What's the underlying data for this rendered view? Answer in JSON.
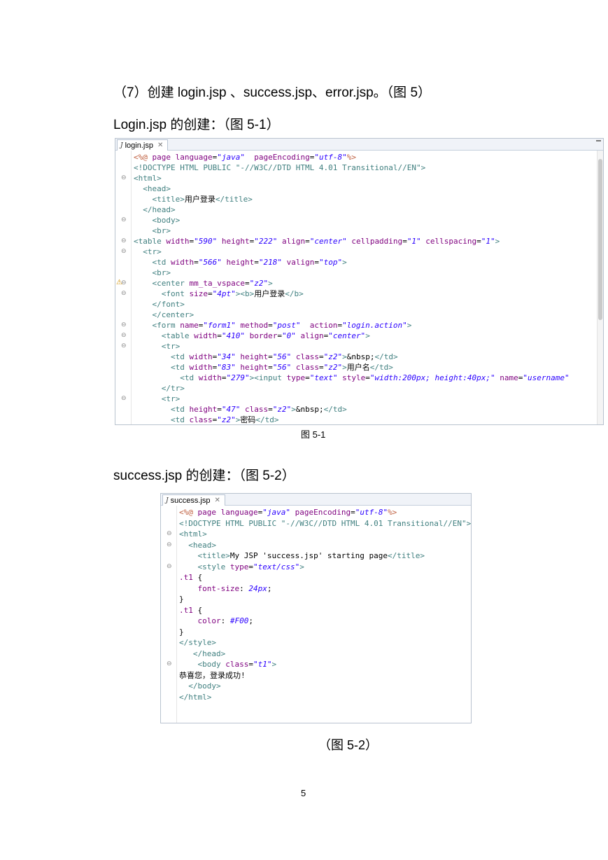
{
  "heading": "（7）创建 login.jsp  、success.jsp、error.jsp。（图 5）",
  "login_intro": "Login.jsp 的创建：（图 5-1）",
  "login_editor": {
    "tab": "login.jsp",
    "lines": [
      [
        [
          "dl",
          "<%@"
        ],
        [
          "at",
          " page "
        ],
        [
          "at",
          "language"
        ],
        [
          "tx",
          "="
        ],
        [
          "vl",
          "\"java\""
        ],
        [
          "tx",
          "  "
        ],
        [
          "at",
          "pageEncoding"
        ],
        [
          "tx",
          "="
        ],
        [
          "vl",
          "\"utf-8\""
        ],
        [
          "dl",
          "%>"
        ]
      ],
      [
        [
          "tg",
          "<!DOCTYPE HTML PUBLIC \"-//W3C//DTD HTML 4.01 Transitional//EN\">"
        ]
      ],
      [
        [
          "tg",
          "<html>"
        ]
      ],
      [
        [
          "tg",
          "  <head>"
        ]
      ],
      [
        [
          "tg",
          "    <title>"
        ],
        [
          "tx",
          "用户登录"
        ],
        [
          "tg",
          "</title>"
        ]
      ],
      [
        [
          "tg",
          "  </head>"
        ]
      ],
      [
        [
          "tg",
          "    <body>"
        ]
      ],
      [
        [
          "tg",
          "    <br>"
        ]
      ],
      [
        [
          "tg",
          "<table "
        ],
        [
          "at",
          "width"
        ],
        [
          "tx",
          "="
        ],
        [
          "vl",
          "\"590\""
        ],
        [
          "at",
          " height"
        ],
        [
          "tx",
          "="
        ],
        [
          "vl",
          "\"222\""
        ],
        [
          "at",
          " align"
        ],
        [
          "tx",
          "="
        ],
        [
          "vl",
          "\"center\""
        ],
        [
          "at",
          " cellpadding"
        ],
        [
          "tx",
          "="
        ],
        [
          "vl",
          "\"1\""
        ],
        [
          "at",
          " cellspacing"
        ],
        [
          "tx",
          "="
        ],
        [
          "vl",
          "\"1\""
        ],
        [
          "tg",
          ">"
        ]
      ],
      [
        [
          "tg",
          "  <tr>"
        ]
      ],
      [
        [
          "tg",
          "    <td "
        ],
        [
          "at",
          "width"
        ],
        [
          "tx",
          "="
        ],
        [
          "vl",
          "\"566\""
        ],
        [
          "at",
          " height"
        ],
        [
          "tx",
          "="
        ],
        [
          "vl",
          "\"218\""
        ],
        [
          "at",
          " valign"
        ],
        [
          "tx",
          "="
        ],
        [
          "vl",
          "\"top\""
        ],
        [
          "tg",
          ">"
        ]
      ],
      [
        [
          "tg",
          "    <br>"
        ]
      ],
      [
        [
          "tg",
          "    <center "
        ],
        [
          "at",
          "mm_ta_vspace"
        ],
        [
          "tx",
          "="
        ],
        [
          "vl",
          "\"z2\""
        ],
        [
          "tg",
          ">"
        ]
      ],
      [
        [
          "tg",
          "      <font "
        ],
        [
          "at",
          "size"
        ],
        [
          "tx",
          "="
        ],
        [
          "vl",
          "\"4pt\""
        ],
        [
          "tg",
          "><b>"
        ],
        [
          "tx",
          "用户登录"
        ],
        [
          "tg",
          "</b>"
        ]
      ],
      [
        [
          "tg",
          "    </font>"
        ]
      ],
      [
        [
          "tg",
          "    </center>"
        ]
      ],
      [
        [
          "tg",
          "    <form "
        ],
        [
          "at",
          "name"
        ],
        [
          "tx",
          "="
        ],
        [
          "vl",
          "\"form1\""
        ],
        [
          "at",
          " method"
        ],
        [
          "tx",
          "="
        ],
        [
          "vl",
          "\"post\""
        ],
        [
          "at",
          "  action"
        ],
        [
          "tx",
          "="
        ],
        [
          "vl",
          "\"login.action\""
        ],
        [
          "tg",
          ">"
        ]
      ],
      [
        [
          "tg",
          "      <table "
        ],
        [
          "at",
          "width"
        ],
        [
          "tx",
          "="
        ],
        [
          "vl",
          "\"410\""
        ],
        [
          "at",
          " border"
        ],
        [
          "tx",
          "="
        ],
        [
          "vl",
          "\"0\""
        ],
        [
          "at",
          " align"
        ],
        [
          "tx",
          "="
        ],
        [
          "vl",
          "\"center\""
        ],
        [
          "tg",
          ">"
        ]
      ],
      [
        [
          "tg",
          "      <tr>"
        ]
      ],
      [
        [
          "tg",
          "        <td "
        ],
        [
          "at",
          "width"
        ],
        [
          "tx",
          "="
        ],
        [
          "vl",
          "\"34\""
        ],
        [
          "at",
          " height"
        ],
        [
          "tx",
          "="
        ],
        [
          "vl",
          "\"56\""
        ],
        [
          "at",
          " class"
        ],
        [
          "tx",
          "="
        ],
        [
          "vl",
          "\"z2\""
        ],
        [
          "tg",
          ">"
        ],
        [
          "tx",
          "&nbsp;"
        ],
        [
          "tg",
          "</td>"
        ]
      ],
      [
        [
          "tg",
          "        <td "
        ],
        [
          "at",
          "width"
        ],
        [
          "tx",
          "="
        ],
        [
          "vl",
          "\"83\""
        ],
        [
          "at",
          " height"
        ],
        [
          "tx",
          "="
        ],
        [
          "vl",
          "\"56\""
        ],
        [
          "at",
          " class"
        ],
        [
          "tx",
          "="
        ],
        [
          "vl",
          "\"z2\""
        ],
        [
          "tg",
          ">"
        ],
        [
          "tx",
          "用户名"
        ],
        [
          "tg",
          "</td>"
        ]
      ],
      [
        [
          "tg",
          "          <td "
        ],
        [
          "at",
          "width"
        ],
        [
          "tx",
          "="
        ],
        [
          "vl",
          "\"279\""
        ],
        [
          "tg",
          "><input "
        ],
        [
          "at",
          "type"
        ],
        [
          "tx",
          "="
        ],
        [
          "vl",
          "\"text\""
        ],
        [
          "at",
          " style"
        ],
        [
          "tx",
          "="
        ],
        [
          "vl",
          "\"width:200px; height:40px;\""
        ],
        [
          "at",
          " name"
        ],
        [
          "tx",
          "="
        ],
        [
          "vl",
          "\"username\""
        ]
      ],
      [
        [
          "tg",
          "      </tr>"
        ]
      ],
      [
        [
          "tg",
          "      <tr>"
        ]
      ],
      [
        [
          "tg",
          "        <td "
        ],
        [
          "at",
          "height"
        ],
        [
          "tx",
          "="
        ],
        [
          "vl",
          "\"47\""
        ],
        [
          "at",
          " class"
        ],
        [
          "tx",
          "="
        ],
        [
          "vl",
          "\"z2\""
        ],
        [
          "tg",
          ">"
        ],
        [
          "tx",
          "&nbsp;"
        ],
        [
          "tg",
          "</td>"
        ]
      ],
      [
        [
          "tg",
          "        <td "
        ],
        [
          "at",
          "class"
        ],
        [
          "tx",
          "="
        ],
        [
          "vl",
          "\"z2\""
        ],
        [
          "tg",
          ">"
        ],
        [
          "tx",
          "密码"
        ],
        [
          "tg",
          "</td>"
        ]
      ]
    ]
  },
  "caption_5_1": "图 5-1",
  "success_intro": "success.jsp 的创建：（图 5-2）",
  "success_editor": {
    "tab": "success.jsp",
    "lines": [
      [
        [
          "dl",
          "<%@"
        ],
        [
          "at",
          " page "
        ],
        [
          "at",
          "language"
        ],
        [
          "tx",
          "="
        ],
        [
          "vl",
          "\"java\""
        ],
        [
          "at",
          " pageEncoding"
        ],
        [
          "tx",
          "="
        ],
        [
          "vl",
          "\"utf-8\""
        ],
        [
          "dl",
          "%>"
        ]
      ],
      [
        [
          "tg",
          "<!DOCTYPE HTML PUBLIC \"-//W3C//DTD HTML 4.01 Transitional//EN\">"
        ]
      ],
      [
        [
          "tg",
          "<html>"
        ]
      ],
      [
        [
          "tg",
          "  <head>"
        ]
      ],
      [
        [
          "tg",
          "    <title>"
        ],
        [
          "tx",
          "My JSP 'success.jsp' starting page"
        ],
        [
          "tg",
          "</title>"
        ]
      ],
      [
        [
          "tg",
          "    <style "
        ],
        [
          "at",
          "type"
        ],
        [
          "tx",
          "="
        ],
        [
          "vl",
          "\"text/css\""
        ],
        [
          "tg",
          ">"
        ]
      ],
      [
        [
          "at",
          ".t1"
        ],
        [
          "tx",
          " {"
        ]
      ],
      [
        [
          "at",
          "    font-size"
        ],
        [
          "tx",
          ": "
        ],
        [
          "vl",
          "24px"
        ],
        [
          "tx",
          ";"
        ]
      ],
      [
        [
          "tx",
          "}"
        ]
      ],
      [
        [
          "at",
          ".t1"
        ],
        [
          "tx",
          " {"
        ]
      ],
      [
        [
          "at",
          "    color"
        ],
        [
          "tx",
          ": "
        ],
        [
          "vl",
          "#F00"
        ],
        [
          "tx",
          ";"
        ]
      ],
      [
        [
          "tx",
          "}"
        ]
      ],
      [
        [
          "tg",
          "</style>"
        ]
      ],
      [
        [
          "tg",
          "   </head>"
        ]
      ],
      [
        [
          "tg",
          "    <body "
        ],
        [
          "at",
          "class"
        ],
        [
          "tx",
          "="
        ],
        [
          "vl",
          "\"t1\""
        ],
        [
          "tg",
          ">"
        ]
      ],
      [
        [
          "tx",
          "恭喜您，登录成功!"
        ]
      ],
      [
        [
          "tg",
          "  </body>"
        ]
      ],
      [
        [
          "tg",
          "</html>"
        ]
      ]
    ]
  },
  "caption_5_2": "（图 5-2）",
  "page_number": "5"
}
